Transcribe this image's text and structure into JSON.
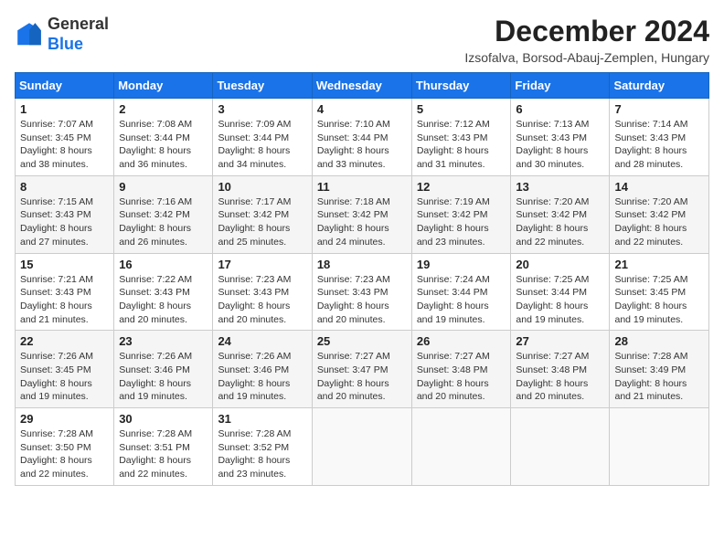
{
  "header": {
    "logo_general": "General",
    "logo_blue": "Blue",
    "month_title": "December 2024",
    "location": "Izsofalva, Borsod-Abauj-Zemplen, Hungary"
  },
  "days_of_week": [
    "Sunday",
    "Monday",
    "Tuesday",
    "Wednesday",
    "Thursday",
    "Friday",
    "Saturday"
  ],
  "weeks": [
    [
      {
        "day": 1,
        "sunrise": "Sunrise: 7:07 AM",
        "sunset": "Sunset: 3:45 PM",
        "daylight": "Daylight: 8 hours and 38 minutes."
      },
      {
        "day": 2,
        "sunrise": "Sunrise: 7:08 AM",
        "sunset": "Sunset: 3:44 PM",
        "daylight": "Daylight: 8 hours and 36 minutes."
      },
      {
        "day": 3,
        "sunrise": "Sunrise: 7:09 AM",
        "sunset": "Sunset: 3:44 PM",
        "daylight": "Daylight: 8 hours and 34 minutes."
      },
      {
        "day": 4,
        "sunrise": "Sunrise: 7:10 AM",
        "sunset": "Sunset: 3:44 PM",
        "daylight": "Daylight: 8 hours and 33 minutes."
      },
      {
        "day": 5,
        "sunrise": "Sunrise: 7:12 AM",
        "sunset": "Sunset: 3:43 PM",
        "daylight": "Daylight: 8 hours and 31 minutes."
      },
      {
        "day": 6,
        "sunrise": "Sunrise: 7:13 AM",
        "sunset": "Sunset: 3:43 PM",
        "daylight": "Daylight: 8 hours and 30 minutes."
      },
      {
        "day": 7,
        "sunrise": "Sunrise: 7:14 AM",
        "sunset": "Sunset: 3:43 PM",
        "daylight": "Daylight: 8 hours and 28 minutes."
      }
    ],
    [
      {
        "day": 8,
        "sunrise": "Sunrise: 7:15 AM",
        "sunset": "Sunset: 3:43 PM",
        "daylight": "Daylight: 8 hours and 27 minutes."
      },
      {
        "day": 9,
        "sunrise": "Sunrise: 7:16 AM",
        "sunset": "Sunset: 3:42 PM",
        "daylight": "Daylight: 8 hours and 26 minutes."
      },
      {
        "day": 10,
        "sunrise": "Sunrise: 7:17 AM",
        "sunset": "Sunset: 3:42 PM",
        "daylight": "Daylight: 8 hours and 25 minutes."
      },
      {
        "day": 11,
        "sunrise": "Sunrise: 7:18 AM",
        "sunset": "Sunset: 3:42 PM",
        "daylight": "Daylight: 8 hours and 24 minutes."
      },
      {
        "day": 12,
        "sunrise": "Sunrise: 7:19 AM",
        "sunset": "Sunset: 3:42 PM",
        "daylight": "Daylight: 8 hours and 23 minutes."
      },
      {
        "day": 13,
        "sunrise": "Sunrise: 7:20 AM",
        "sunset": "Sunset: 3:42 PM",
        "daylight": "Daylight: 8 hours and 22 minutes."
      },
      {
        "day": 14,
        "sunrise": "Sunrise: 7:20 AM",
        "sunset": "Sunset: 3:42 PM",
        "daylight": "Daylight: 8 hours and 22 minutes."
      }
    ],
    [
      {
        "day": 15,
        "sunrise": "Sunrise: 7:21 AM",
        "sunset": "Sunset: 3:43 PM",
        "daylight": "Daylight: 8 hours and 21 minutes."
      },
      {
        "day": 16,
        "sunrise": "Sunrise: 7:22 AM",
        "sunset": "Sunset: 3:43 PM",
        "daylight": "Daylight: 8 hours and 20 minutes."
      },
      {
        "day": 17,
        "sunrise": "Sunrise: 7:23 AM",
        "sunset": "Sunset: 3:43 PM",
        "daylight": "Daylight: 8 hours and 20 minutes."
      },
      {
        "day": 18,
        "sunrise": "Sunrise: 7:23 AM",
        "sunset": "Sunset: 3:43 PM",
        "daylight": "Daylight: 8 hours and 20 minutes."
      },
      {
        "day": 19,
        "sunrise": "Sunrise: 7:24 AM",
        "sunset": "Sunset: 3:44 PM",
        "daylight": "Daylight: 8 hours and 19 minutes."
      },
      {
        "day": 20,
        "sunrise": "Sunrise: 7:25 AM",
        "sunset": "Sunset: 3:44 PM",
        "daylight": "Daylight: 8 hours and 19 minutes."
      },
      {
        "day": 21,
        "sunrise": "Sunrise: 7:25 AM",
        "sunset": "Sunset: 3:45 PM",
        "daylight": "Daylight: 8 hours and 19 minutes."
      }
    ],
    [
      {
        "day": 22,
        "sunrise": "Sunrise: 7:26 AM",
        "sunset": "Sunset: 3:45 PM",
        "daylight": "Daylight: 8 hours and 19 minutes."
      },
      {
        "day": 23,
        "sunrise": "Sunrise: 7:26 AM",
        "sunset": "Sunset: 3:46 PM",
        "daylight": "Daylight: 8 hours and 19 minutes."
      },
      {
        "day": 24,
        "sunrise": "Sunrise: 7:26 AM",
        "sunset": "Sunset: 3:46 PM",
        "daylight": "Daylight: 8 hours and 19 minutes."
      },
      {
        "day": 25,
        "sunrise": "Sunrise: 7:27 AM",
        "sunset": "Sunset: 3:47 PM",
        "daylight": "Daylight: 8 hours and 20 minutes."
      },
      {
        "day": 26,
        "sunrise": "Sunrise: 7:27 AM",
        "sunset": "Sunset: 3:48 PM",
        "daylight": "Daylight: 8 hours and 20 minutes."
      },
      {
        "day": 27,
        "sunrise": "Sunrise: 7:27 AM",
        "sunset": "Sunset: 3:48 PM",
        "daylight": "Daylight: 8 hours and 20 minutes."
      },
      {
        "day": 28,
        "sunrise": "Sunrise: 7:28 AM",
        "sunset": "Sunset: 3:49 PM",
        "daylight": "Daylight: 8 hours and 21 minutes."
      }
    ],
    [
      {
        "day": 29,
        "sunrise": "Sunrise: 7:28 AM",
        "sunset": "Sunset: 3:50 PM",
        "daylight": "Daylight: 8 hours and 22 minutes."
      },
      {
        "day": 30,
        "sunrise": "Sunrise: 7:28 AM",
        "sunset": "Sunset: 3:51 PM",
        "daylight": "Daylight: 8 hours and 22 minutes."
      },
      {
        "day": 31,
        "sunrise": "Sunrise: 7:28 AM",
        "sunset": "Sunset: 3:52 PM",
        "daylight": "Daylight: 8 hours and 23 minutes."
      },
      null,
      null,
      null,
      null
    ]
  ]
}
